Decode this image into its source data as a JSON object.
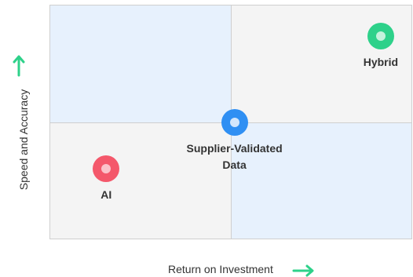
{
  "axes": {
    "x_title": "Return on Investment",
    "y_title": "Speed and Accuracy",
    "arrow_color": "#2ed18a"
  },
  "quadrant_colors": {
    "top_left": "#e7f1fd",
    "top_right": "#f4f4f4",
    "bottom_left": "#f4f4f4",
    "bottom_right": "#e7f1fd"
  },
  "points": [
    {
      "id": "ai",
      "label": "AI",
      "x": 0.155,
      "y": 0.3,
      "ring_color": "#f4586b",
      "core_color": "#fbc3ca"
    },
    {
      "id": "supplier-validated",
      "label": "Supplier-Validated\nData",
      "x": 0.51,
      "y": 0.5,
      "ring_color": "#2f8ff3",
      "core_color": "#d3e6fc"
    },
    {
      "id": "hybrid",
      "label": "Hybrid",
      "x": 0.915,
      "y": 0.87,
      "ring_color": "#2ed18a",
      "core_color": "#c4f2dc"
    }
  ]
}
